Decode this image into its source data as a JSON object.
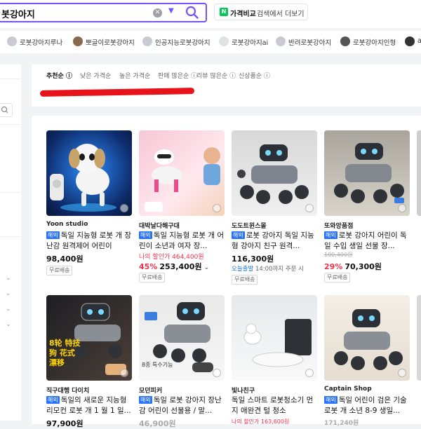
{
  "search": {
    "query": "봇강아지"
  },
  "compare": {
    "badge": "N",
    "strong": "가격비교",
    "rest": " 검색에서 더보기"
  },
  "chips": [
    {
      "label": "로봇강아지루나"
    },
    {
      "label": "뽀글이로봇강아지"
    },
    {
      "label": "인공지능로봇강아지"
    },
    {
      "label": "로봇강아지ai"
    },
    {
      "label": "반려로봇강아지"
    },
    {
      "label": "로봇강아지인형"
    },
    {
      "label": "a"
    }
  ],
  "sort": [
    {
      "label": "추천순 ⓘ"
    },
    {
      "label": "낮은 가격순"
    },
    {
      "label": "높은 가격순"
    },
    {
      "label": "판매 많은순 ⓘ"
    },
    {
      "label": "리뷰 많은순 ⓘ"
    },
    {
      "label": "신상품순 ⓘ"
    }
  ],
  "products": [
    {
      "seller": "Yoon studio",
      "tag": "해외",
      "title": "독일 지능형 로봇 개 장난감 원격제어 어린이",
      "price": "98,400원",
      "ship": "무료배송"
    },
    {
      "seller": "대박날다해구대",
      "tag": "해외",
      "title": "독일 지능형 로봇 개 어린이 소년과 여자 장...",
      "pink": "나의 할인가 464,400원",
      "discount": "45%",
      "price": "253,400원",
      "ship": "무료배송"
    },
    {
      "seller": "도도트윈스몰",
      "tag": "해외",
      "title": "로봇 강아지 독일 지능형 강아지 친구 원격...",
      "price": "116,300원",
      "deliv_strong": "오늘출발",
      "deliv_rest": "14:00까지 주문 시",
      "ship": "무료배송"
    },
    {
      "seller": "또와앙품점",
      "tag": "해외",
      "title": "로봇 강아지 어린이 독일 수입 생일 선물 장...",
      "orig": "100,400원",
      "discount": "29%",
      "price": "70,300원",
      "ship": "무료배송"
    },
    {
      "seller": "직구대행 다이치",
      "tag": "해외",
      "title": "독일의 새로운 지능형 리모컨 로봇 개 1 월 1 일...",
      "price": "97,900원"
    },
    {
      "seller": "모던피커",
      "tag": "해외",
      "title": "독일 로봇 강아지 장난감 어린이 선물용 / 말...",
      "price": "46,900원"
    },
    {
      "seller": "빛나친구",
      "tag": "",
      "title": "독일 스마트 로봇청소기 먼지 애완견 털 청소",
      "pink": "나의 할인가 163,600원"
    },
    {
      "seller": "Captain Shop",
      "tag": "해외",
      "title": "독일 어린이 검은 기술 로봇 개 소년 8-9 생일...",
      "price": "171,240원"
    }
  ],
  "product_overlays": {
    "p5_text": "8轮 特技狗 花式漂移",
    "p6_text": "8종 특수기능"
  },
  "colors": {
    "accent": "#7453ff",
    "naver_green": "#03c75a",
    "sale_red": "#f0324c",
    "tag_blue": "#2a73ff",
    "redaction": "#e8131a"
  }
}
